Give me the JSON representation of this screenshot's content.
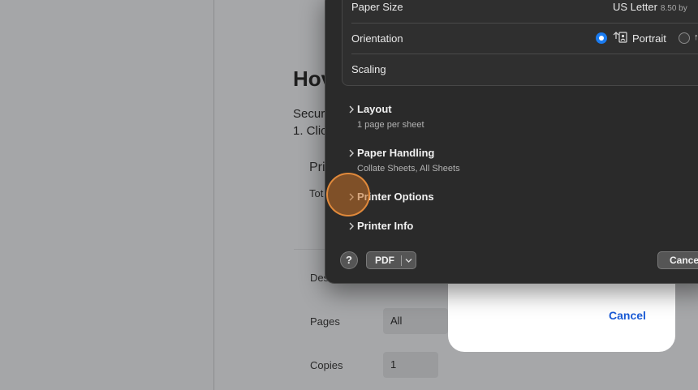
{
  "background": {
    "heading": "Hov",
    "line1": "Secur",
    "line2": "1. Clic",
    "preview_label": "Pri",
    "total_label": "Tot",
    "dest_label": "Des",
    "pages_label": "Pages",
    "pages_value": "All",
    "copies_label": "Copies",
    "copies_value": "1"
  },
  "sheet": {
    "cancel_label": "Cancel"
  },
  "dialog": {
    "paper_size": {
      "label": "Paper Size",
      "value": "US Letter",
      "detail": "8.50 by"
    },
    "orientation": {
      "label": "Orientation",
      "selected": "Portrait",
      "portrait_label": "Portrait"
    },
    "scaling": {
      "label": "Scaling"
    },
    "sections": [
      {
        "title": "Layout",
        "subtitle": "1 page per sheet"
      },
      {
        "title": "Paper Handling",
        "subtitle": "Collate Sheets, All Sheets"
      },
      {
        "title": "Printer Options",
        "subtitle": ""
      },
      {
        "title": "Printer Info",
        "subtitle": ""
      }
    ],
    "footer": {
      "help_label": "?",
      "pdf_label": "PDF",
      "cancel_label": "Cance"
    }
  },
  "colors": {
    "accent": "#1a7bf0",
    "sheet_link": "#1a5bd6",
    "click_highlight": "#c47026"
  }
}
